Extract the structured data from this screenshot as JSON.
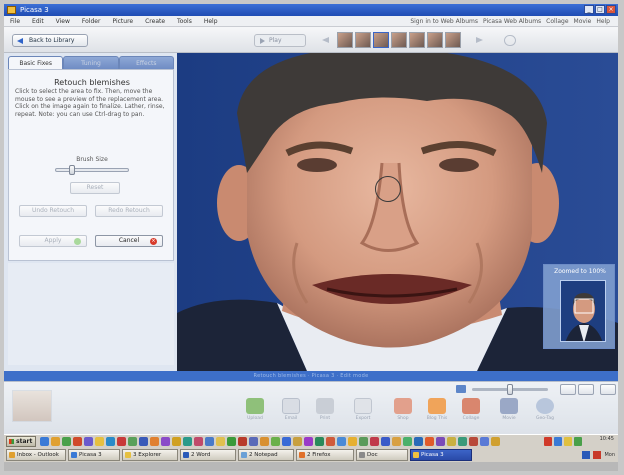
{
  "window": {
    "title": "Picasa 3",
    "menus": [
      "File",
      "Edit",
      "View",
      "Folder",
      "Picture",
      "Create",
      "Tools",
      "Help"
    ],
    "menu_right": [
      "Sign in to Web Albums",
      "Picasa Web Albums",
      "Collage",
      "Movie",
      "Help"
    ]
  },
  "toolbar": {
    "back_label": "Back to Library",
    "play_label": "Play"
  },
  "panel": {
    "tabs": [
      "Basic Fixes",
      "Tuning",
      "Effects"
    ],
    "title": "Retouch blemishes",
    "instructions": "Click to select the area to fix. Then, move the mouse to see a preview of the replacement area. Click on the image again to finalize. Lather, rinse, repeat. Note: you can use Ctrl-drag to pan.",
    "brush_label": "Brush Size",
    "brush_size": 0.2,
    "reset_label": "Reset",
    "undo_label": "Undo Retouch",
    "redo_label": "Redo Retouch",
    "apply_label": "Apply",
    "cancel_label": "Cancel"
  },
  "zoom_nav": {
    "label": "Zoomed to 100%"
  },
  "status_strip": "Retouch blemishes · Picasa 3 · Edit mode",
  "bottom_bar": {
    "zoom_level": 0.5,
    "tasks": [
      "Upload",
      "Email",
      "Print",
      "Export",
      "Shop",
      "Blog This",
      "Collage",
      "Movie",
      "Geo-Tag"
    ]
  },
  "taskbar": {
    "start_label": "start",
    "buttons": [
      {
        "label": "Inbox - Outlook",
        "active": false
      },
      {
        "label": "Picasa 3",
        "active": false
      },
      {
        "label": "3 Explorer",
        "active": false
      },
      {
        "label": "2 Word",
        "active": false
      },
      {
        "label": "2 Notepad",
        "active": false
      },
      {
        "label": "2 Firefox",
        "active": false
      },
      {
        "label": "Doc",
        "active": false
      },
      {
        "label": "Picasa 3",
        "active": true
      }
    ],
    "clock_time": "10:45",
    "clock_day": "Mon"
  },
  "colors": {
    "accent": "#2e63c9",
    "panel_bg": "#f4f6fa",
    "photo_bg": "#1a3a7a",
    "cancel_icon": "#d83a2a",
    "apply_icon": "#a9d99c"
  }
}
